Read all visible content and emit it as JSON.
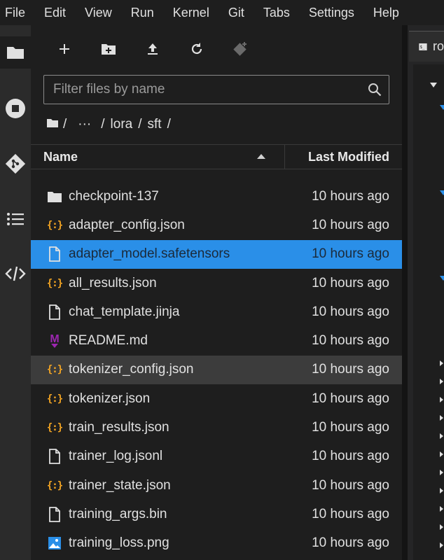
{
  "menubar": {
    "items": [
      "File",
      "Edit",
      "View",
      "Run",
      "Kernel",
      "Git",
      "Tabs",
      "Settings",
      "Help"
    ]
  },
  "activity": {
    "icons": [
      "folder-icon",
      "running-icon",
      "git-icon",
      "table-of-contents-icon",
      "code-icon"
    ]
  },
  "toolbar": {
    "icons": [
      "new-launcher-icon",
      "new-folder-icon",
      "upload-icon",
      "refresh-icon",
      "git-clone-icon"
    ]
  },
  "filter": {
    "placeholder": "Filter files by name",
    "value": ""
  },
  "breadcrumb": {
    "root": "/",
    "ellipsis": "···",
    "parts": [
      "lora",
      "sft"
    ]
  },
  "header": {
    "name": "Name",
    "modified": "Last Modified",
    "sort": "ascending"
  },
  "files": [
    {
      "name": "checkpoint-137",
      "modified": "10 hours ago",
      "icon": "folder-icon"
    },
    {
      "name": "adapter_config.json",
      "modified": "10 hours ago",
      "icon": "json-icon"
    },
    {
      "name": "adapter_model.safetensors",
      "modified": "10 hours ago",
      "icon": "file-icon"
    },
    {
      "name": "all_results.json",
      "modified": "10 hours ago",
      "icon": "json-icon"
    },
    {
      "name": "chat_template.jinja",
      "modified": "10 hours ago",
      "icon": "file-icon"
    },
    {
      "name": "README.md",
      "modified": "10 hours ago",
      "icon": "markdown-icon"
    },
    {
      "name": "tokenizer_config.json",
      "modified": "10 hours ago",
      "icon": "json-icon"
    },
    {
      "name": "tokenizer.json",
      "modified": "10 hours ago",
      "icon": "json-icon"
    },
    {
      "name": "train_results.json",
      "modified": "10 hours ago",
      "icon": "json-icon"
    },
    {
      "name": "trainer_log.jsonl",
      "modified": "10 hours ago",
      "icon": "file-icon"
    },
    {
      "name": "trainer_state.json",
      "modified": "10 hours ago",
      "icon": "json-icon"
    },
    {
      "name": "training_args.bin",
      "modified": "10 hours ago",
      "icon": "file-icon"
    },
    {
      "name": "training_loss.png",
      "modified": "10 hours ago",
      "icon": "image-icon"
    }
  ],
  "selected_file": "adapter_model.safetensors",
  "hovered_file": "tokenizer_config.json",
  "json_icon_glyph": "{:}",
  "markdown_icon_glyph": "M",
  "right_panel": {
    "tab_icon": "terminal-icon",
    "tab_icon_glyph": "$_",
    "tab_label": "ro"
  },
  "colors": {
    "selection": "#2a8fe8",
    "hover_row": "#3c3c3c",
    "json_icon": "#f5a623",
    "markdown_icon": "#9c27b0"
  }
}
